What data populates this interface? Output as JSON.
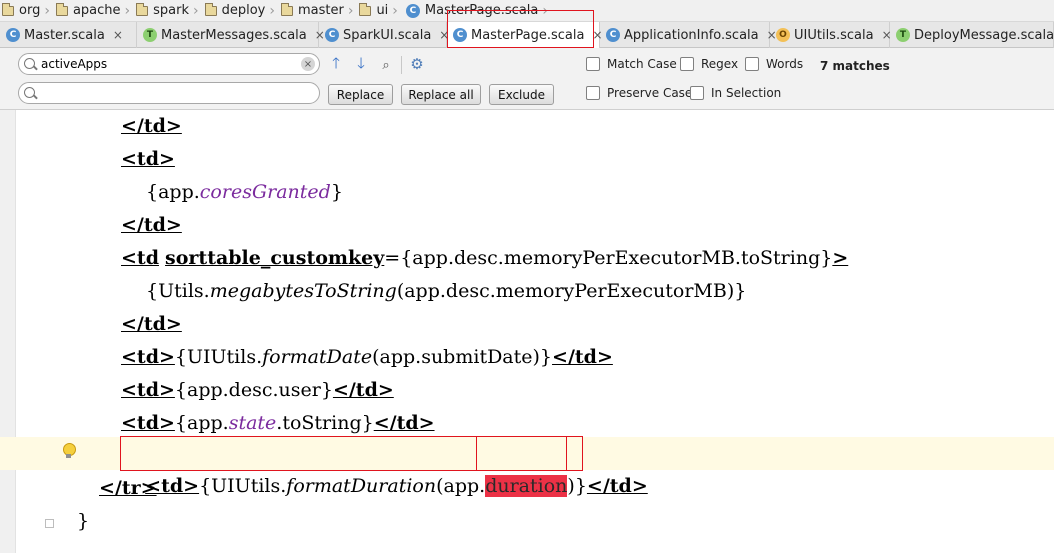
{
  "breadcrumb": [
    "org",
    "apache",
    "spark",
    "deploy",
    "master",
    "ui",
    "MasterPage.scala"
  ],
  "tabs": [
    {
      "label": "Master.scala",
      "kind": "C",
      "active": false
    },
    {
      "label": "MasterMessages.scala",
      "kind": "T",
      "active": false
    },
    {
      "label": "SparkUI.scala",
      "kind": "C",
      "active": false
    },
    {
      "label": "MasterPage.scala",
      "kind": "C",
      "active": true
    },
    {
      "label": "ApplicationInfo.scala",
      "kind": "C",
      "active": false
    },
    {
      "label": "UIUtils.scala",
      "kind": "O",
      "active": false
    },
    {
      "label": "DeployMessage.scala",
      "kind": "T",
      "active": false
    }
  ],
  "search": {
    "find_value": "activeApps",
    "replace_value": "",
    "replace_label": "Replace",
    "replace_all_label": "Replace all",
    "exclude_label": "Exclude",
    "match_case_label": "Match Case",
    "regex_label": "Regex",
    "words_label": "Words",
    "preserve_case_label": "Preserve Case",
    "in_selection_label": "In Selection",
    "matches_label": "7 matches"
  },
  "icons": {
    "up": "arrow-up-icon",
    "down": "arrow-down-icon",
    "find_all": "find-all-icon",
    "settings": "gear-icon"
  },
  "colors": {
    "highlight_border": "#e0141e",
    "match_fill": "#ec3146",
    "purple_field": "#7b2b9e"
  },
  "code": {
    "l1": "</td>",
    "l2": "<td>",
    "l3_open": "{app.",
    "l3_field": "coresGranted",
    "l3_close": "}",
    "l4": "</td>",
    "l5_tag": "<td",
    "l5_attr": "sorttable_customkey",
    "l5_eq": "=",
    "l5_expr": "{app.desc.memoryPerExecutorMB.toString}",
    "l5_end": ">",
    "l6_open": "{Utils.",
    "l6_fn": "megabytesToString",
    "l6_rest": "(app.desc.memoryPerExecutorMB)}",
    "l7": "</td>",
    "l8_open": "<td>",
    "l8_a": "{UIUtils.",
    "l8_fn": "formatDate",
    "l8_b": "(app.submitDate)}",
    "l8_close": "</td>",
    "l9_open": "<td>",
    "l9_expr": "{app.desc.user}",
    "l9_close": "</td>",
    "l10_open": "<td>",
    "l10_a": "{app.",
    "l10_field": "state",
    "l10_b": ".toString}",
    "l10_close": "</td>",
    "l11_open": "<td>",
    "l11_a": "{UIUtils.",
    "l11_fn": "formatDuration",
    "l11_b": "(app.",
    "l11_hit": "duration",
    "l11_c": ")}",
    "l11_close": "</td>",
    "l12": "</tr>",
    "l13": "}"
  }
}
